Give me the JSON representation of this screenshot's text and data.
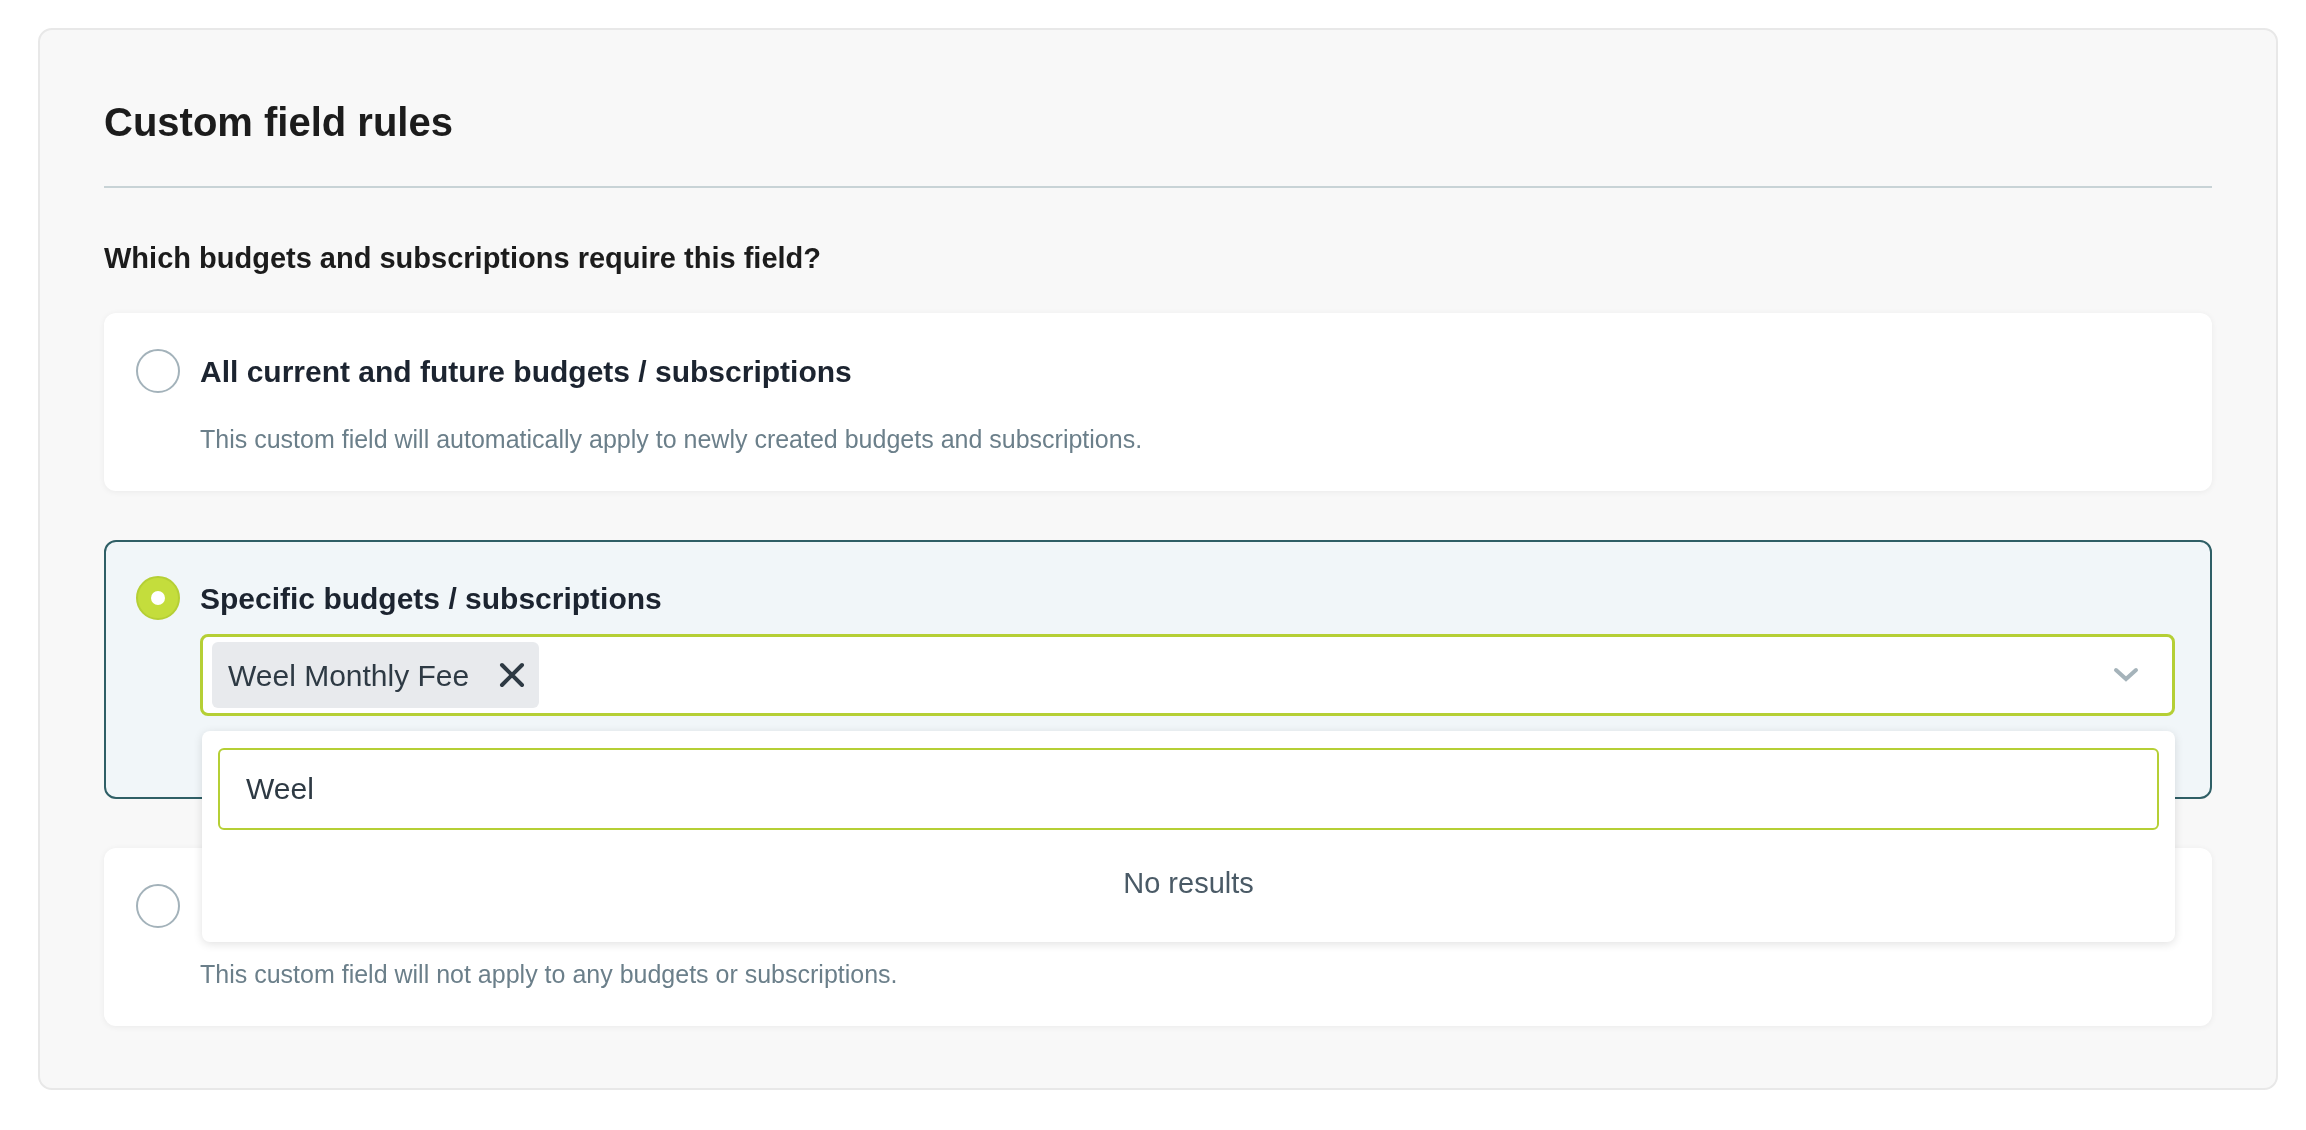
{
  "section": {
    "title": "Custom field rules",
    "question": "Which budgets and subscriptions require this field?"
  },
  "options": [
    {
      "label": "All current and future budgets / subscriptions",
      "description": "This custom field will automatically apply to newly created budgets and subscriptions.",
      "selected": false
    },
    {
      "label": "Specific budgets / subscriptions",
      "selected": true,
      "select": {
        "tags": [
          {
            "label": "Weel Monthly Fee"
          }
        ],
        "expanded": true,
        "search_value": "Weel",
        "empty_text": "No results"
      }
    },
    {
      "description": "This custom field will not apply to any budgets or subscriptions.",
      "selected": false
    }
  ]
}
